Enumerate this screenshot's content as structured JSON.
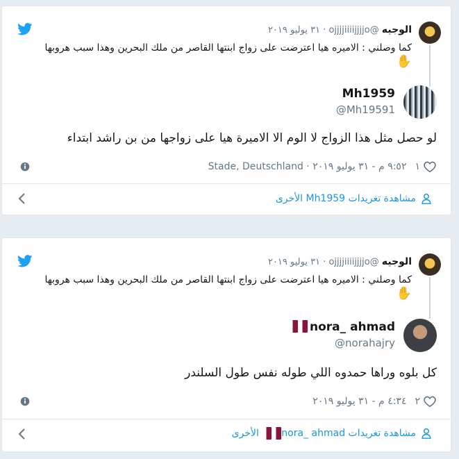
{
  "colors": {
    "accent": "#1da1f2",
    "link": "#1b95e0",
    "muted": "#657786",
    "text": "#14171a"
  },
  "cards": [
    {
      "quoted": {
        "name": "الوجيه",
        "handle": "@ojjjjiiiijjjjo",
        "date": "٣١ يوليو ٢٠١٩",
        "text": "كما وصلني : الاميره هيا اعترضت على زواج ابنتها القاصر من ملك البحرين وهذا سبب هروبها",
        "emoji": "✋"
      },
      "author": {
        "name": "Mh1959",
        "handle": "@Mh19591",
        "flags": []
      },
      "text": "لو حصل مثل هذا الزواج لا الوم الا الاميرة هيا على زواجها من بن راشد ابتداء",
      "likes": "١",
      "time": "٩:٥٢ م - ٣١ يوليو ٢٠١٩",
      "location": "Stade, Deutschland",
      "more": {
        "prefix": "مشاهدة تغريدات",
        "name": "Mh1959",
        "suffix": "الأخرى"
      }
    },
    {
      "quoted": {
        "name": "الوجيه",
        "handle": "@ojjjjiiiijjjjo",
        "date": "٣١ يوليو ٢٠١٩",
        "text": "كما وصلني : الاميره هيا اعترضت على زواج ابنتها القاصر من ملك البحرين وهذا سبب هروبها",
        "emoji": "✋"
      },
      "author": {
        "name": "nora_ ahmad",
        "handle": "@norahajry",
        "flags": [
          "qatar-flag",
          "qatar-flag"
        ]
      },
      "text": "كل بلوه وراها حمدوه اللي طوله نفس طول السلندر",
      "likes": "٢",
      "time": "٤:٣٤ م - ٣١ يوليو ٢٠١٩",
      "location": "",
      "more": {
        "prefix": "مشاهدة تغريدات",
        "name": "nora_ ahmad",
        "suffix": "الأخرى"
      }
    }
  ]
}
